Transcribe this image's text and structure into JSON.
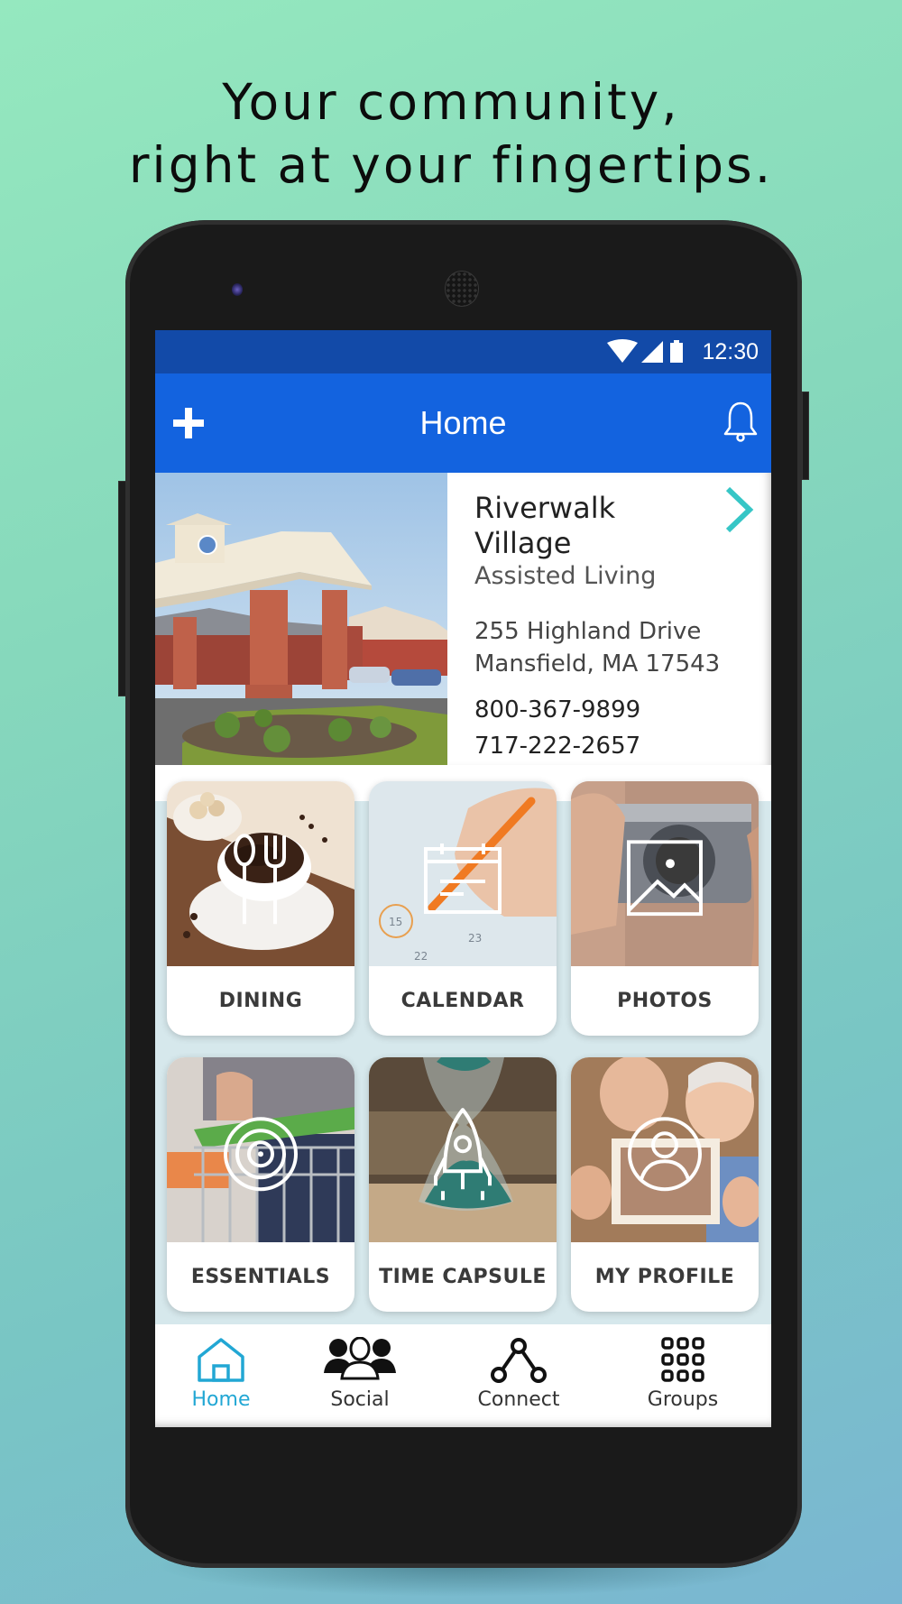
{
  "headline": {
    "line1": "Your community,",
    "line2": "right at your fingertips."
  },
  "status_bar": {
    "time": "12:30",
    "icons": [
      "wifi-icon",
      "cellular-signal-icon",
      "battery-icon"
    ]
  },
  "app_bar": {
    "title": "Home",
    "left_icon": "plus-icon",
    "right_icon": "bell-icon"
  },
  "community": {
    "name": "Riverwalk Village",
    "type": "Assisted Living",
    "address_line1": "255 Highland Drive",
    "address_line2": "Mansfield, MA 17543",
    "phone1": "800-367-9899",
    "phone2": "717-222-2657",
    "detail_icon": "chevron-right-icon",
    "accent_color": "#36c6c6"
  },
  "tiles": [
    {
      "label": "DINING",
      "icon": "utensils-icon"
    },
    {
      "label": "CALENDAR",
      "icon": "calendar-icon"
    },
    {
      "label": "PHOTOS",
      "icon": "image-icon"
    },
    {
      "label": "ESSENTIALS",
      "icon": "target-icon"
    },
    {
      "label": "TIME CAPSULE",
      "icon": "rocket-icon"
    },
    {
      "label": "MY PROFILE",
      "icon": "user-circle-icon"
    }
  ],
  "bottom_nav": {
    "active": "Home",
    "active_color": "#22a7d4",
    "items": [
      {
        "label": "Home",
        "icon": "home-icon"
      },
      {
        "label": "Social",
        "icon": "people-icon"
      },
      {
        "label": "Connect",
        "icon": "connect-nodes-icon"
      },
      {
        "label": "Groups",
        "icon": "grid-icon"
      }
    ]
  },
  "colors": {
    "status_bar": "#124aa8",
    "app_bar": "#1363df",
    "tile_area": "#d6e8ec"
  }
}
